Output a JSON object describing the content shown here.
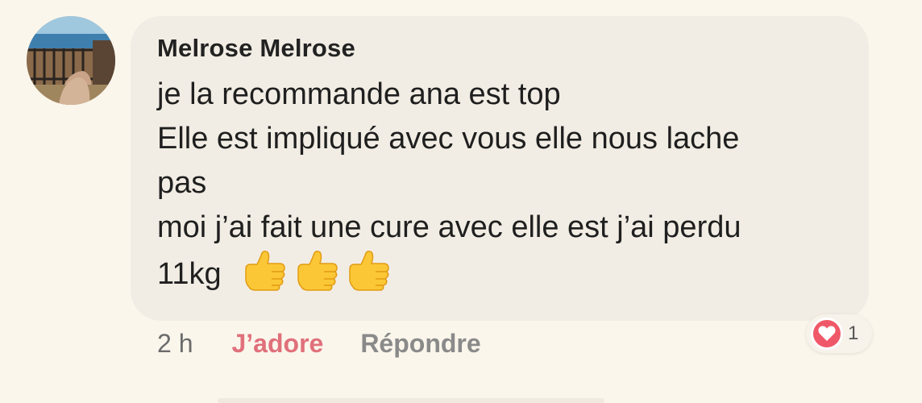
{
  "comment": {
    "author": "Melrose Melrose",
    "lines": [
      "je la recommande ana est top",
      "Elle est impliqué avec vous elle nous lache",
      "pas",
      "moi j’ai fait une cure avec elle est j’ai perdu",
      "11kg"
    ],
    "emoji": [
      "thumbs-up",
      "thumbs-up",
      "thumbs-up"
    ]
  },
  "actions": {
    "time": "2 h",
    "like_label": "J’adore",
    "reply_label": "Répondre"
  },
  "reactions": {
    "icon": "heart-icon",
    "count": "1",
    "color": "#ef5868"
  },
  "colors": {
    "background": "#fbf6ec",
    "bubble": "#f2ede4",
    "like": "#e0707b"
  }
}
